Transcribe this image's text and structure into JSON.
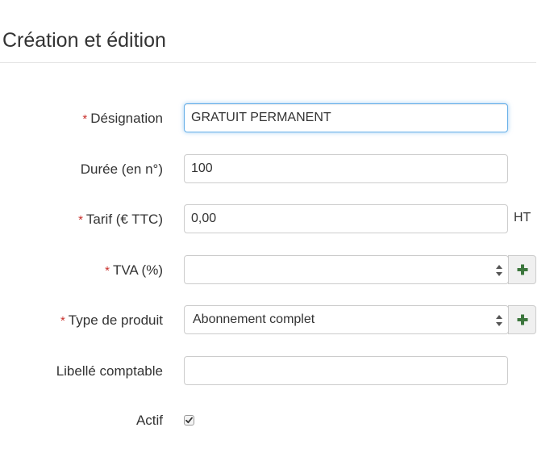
{
  "section": {
    "title": "Création et édition"
  },
  "form": {
    "designation": {
      "label": "Désignation",
      "required": true,
      "value": "GRATUIT PERMANENT"
    },
    "duree": {
      "label": "Durée (en n°)",
      "required": false,
      "value": "100"
    },
    "tarif": {
      "label": "Tarif (€ TTC)",
      "required": true,
      "value": "0,00",
      "suffix": "HT"
    },
    "tva": {
      "label": "TVA (%)",
      "required": true,
      "selected": ""
    },
    "type_produit": {
      "label": "Type de produit",
      "required": true,
      "selected": "Abonnement complet"
    },
    "libelle": {
      "label": "Libellé comptable",
      "required": false,
      "value": ""
    },
    "actif": {
      "label": "Actif",
      "checked": true
    }
  },
  "required_marker": "*",
  "icons": {
    "add": "plus-icon",
    "select_arrows": "updown-arrows-icon",
    "check": "checkmark-icon"
  },
  "colors": {
    "required": "#c9302c",
    "add_icon": "#3c763d",
    "focus_border": "#66afe9"
  }
}
